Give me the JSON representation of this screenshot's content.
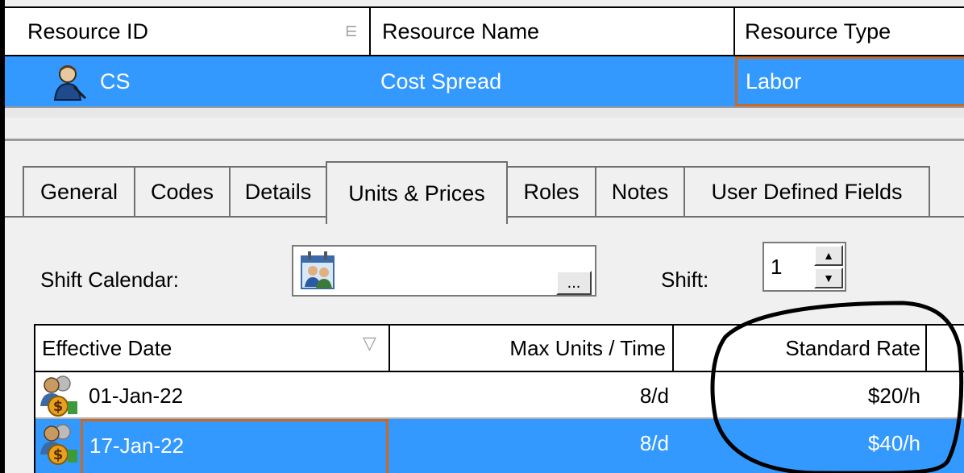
{
  "resource_grid": {
    "headers": {
      "resource_id": "Resource ID",
      "resource_name": "Resource Name",
      "resource_type": "Resource Type"
    },
    "selected_row": {
      "resource_id": "CS",
      "resource_name": "Cost Spread",
      "resource_type": "Labor",
      "icon": "labor-resource-icon"
    }
  },
  "tabs": [
    {
      "label": "General",
      "active": false
    },
    {
      "label": "Codes",
      "active": false
    },
    {
      "label": "Details",
      "active": false
    },
    {
      "label": "Units & Prices",
      "active": true
    },
    {
      "label": "Roles",
      "active": false
    },
    {
      "label": "Notes",
      "active": false
    },
    {
      "label": "User Defined Fields",
      "active": false
    }
  ],
  "units_prices": {
    "shift_calendar_label": "Shift Calendar:",
    "shift_calendar_value": "",
    "browse_button_label": "...",
    "shift_label": "Shift:",
    "shift_value": "1"
  },
  "price_grid": {
    "headers": {
      "effective_date": "Effective Date",
      "max_units": "Max Units / Time",
      "standard_rate": "Standard Rate"
    },
    "rows": [
      {
        "effective_date": "01-Jan-22",
        "max_units": "8/d",
        "standard_rate": "$20/h",
        "selected": false
      },
      {
        "effective_date": "17-Jan-22",
        "max_units": "8/d",
        "standard_rate": "$40/h",
        "selected": true
      }
    ]
  },
  "colors": {
    "selection": "#3399ff",
    "focus_border": "#c8692a",
    "annotation": "#000000"
  }
}
